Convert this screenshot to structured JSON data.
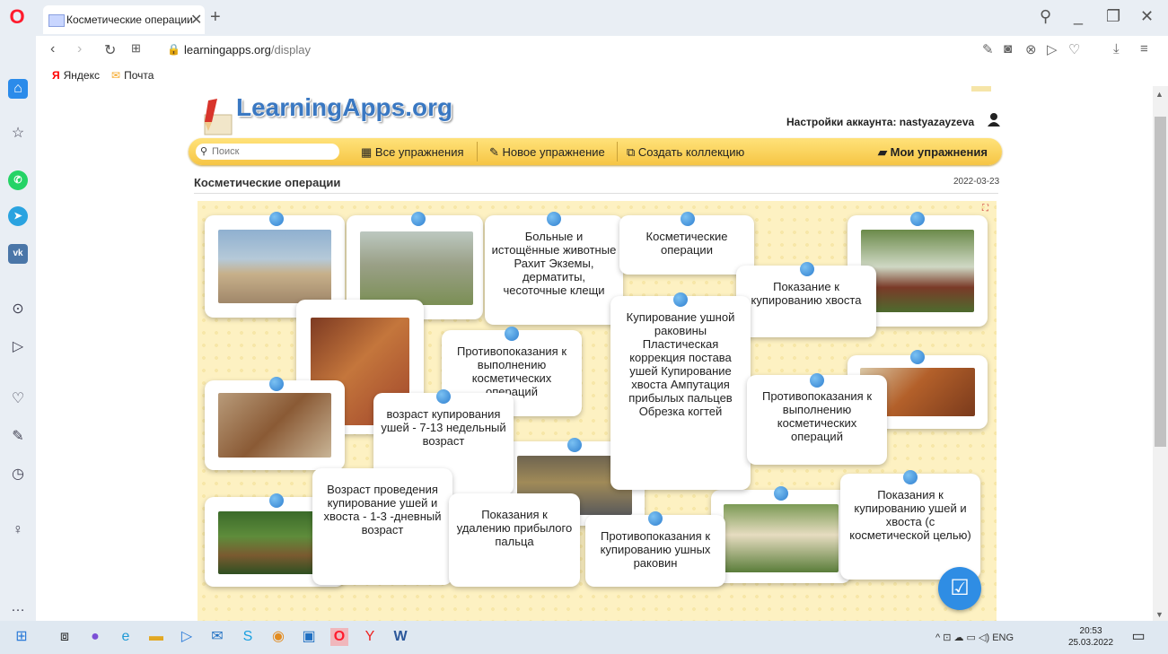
{
  "browser": {
    "tab_title": "Косметические операции",
    "new_tab": "+",
    "url_host": "learningapps.org",
    "url_path": "/display",
    "bookmarks": [
      "Яндекс",
      "Почта"
    ]
  },
  "site": {
    "logo": "LearningApps.org",
    "account": "Настройки аккаунта: nastyazayzeva",
    "search_placeholder": "Поиск",
    "nav": {
      "all": "Все упражнения",
      "new": "Новое упражнение",
      "collection": "Создать коллекцию",
      "mine": "Мои упражнения"
    },
    "title": "Косметические операции",
    "date": "2022-03-23"
  },
  "cards": {
    "sick": "Больные и истощённые животные Рахит Экземы, дерматиты, чесоточные клещи",
    "cosmetic": "Косметические операции",
    "tail_ind": "Показание к купированию хвоста",
    "list": "Купирование ушной раковины Пластическая коррекция постава ушей Купирование хвоста Ампутация прибылых пальцев Обрезка когтей",
    "contra1": "Противопоказания к выполнению косметических операций",
    "contra2": "Противопоказания к выполнению косметических операций",
    "age_ears": "возраст купирования ушей - 7-13 недельный возраст",
    "age_tail": "Возраст проведения купирование ушей и хвоста - 1-3 -дневный возраст",
    "dewclaw": "Показания к удалению прибылого пальца",
    "contra_ears": "Противопоказания к купированию ушных раковин",
    "ear_tail_ind": "Показания к купированию ушей и хвоста (с косметической целью)"
  },
  "taskbar": {
    "lang": "ENG",
    "time": "20:53",
    "date": "25.03.2022"
  },
  "colors": {
    "accent": "#2f8de4",
    "navbar": "#f6c544",
    "board": "#fdf1c2"
  }
}
